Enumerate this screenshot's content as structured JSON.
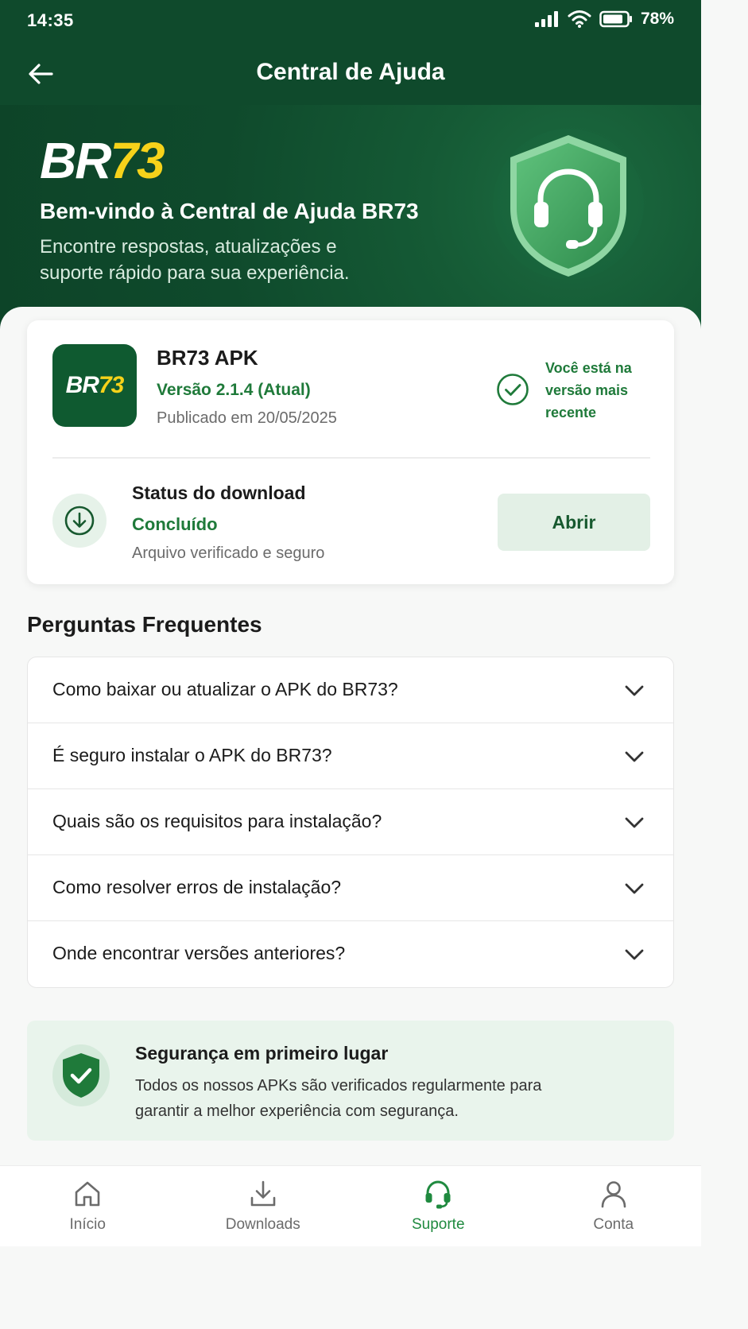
{
  "status_bar": {
    "time": "14:35",
    "battery": "78%"
  },
  "app_bar": {
    "title": "Central de Ajuda"
  },
  "hero": {
    "logo_br": "BR",
    "logo_num": "73",
    "title": "Bem-vindo à Central de Ajuda BR73",
    "subtitle": "Encontre respostas, atualizações e suporte rápido para sua experiência."
  },
  "app_card": {
    "icon_br": "BR",
    "icon_num": "73",
    "name": "BR73 APK",
    "version": "Versão 2.1.4 (Atual)",
    "published": "Publicado em 20/05/2025",
    "latest_notice": "Você está na versão mais recente",
    "download_title": "Status do download",
    "download_state": "Concluído",
    "download_note": "Arquivo verificado e seguro",
    "open_label": "Abrir"
  },
  "faq": {
    "heading": "Perguntas Frequentes",
    "items": [
      {
        "question": "Como baixar ou atualizar o APK do BR73?"
      },
      {
        "question": "É seguro instalar o APK do BR73?"
      },
      {
        "question": "Quais são os requisitos para instalação?"
      },
      {
        "question": "Como resolver erros de instalação?"
      },
      {
        "question": "Onde encontrar versões anteriores?"
      }
    ]
  },
  "security": {
    "title": "Segurança em primeiro lugar",
    "text": "Todos os nossos APKs são verificados regularmente para garantir a melhor experiência com segurança."
  },
  "bottom_nav": {
    "items": [
      {
        "label": "Início",
        "icon": "home-icon"
      },
      {
        "label": "Downloads",
        "icon": "download-icon"
      },
      {
        "label": "Suporte",
        "icon": "headset-icon"
      },
      {
        "label": "Conta",
        "icon": "user-icon"
      }
    ],
    "active": "Suporte"
  },
  "colors": {
    "primary_dark": "#0f4a2c",
    "accent_green": "#1f7a3a",
    "logo_yellow": "#f6d21a"
  }
}
